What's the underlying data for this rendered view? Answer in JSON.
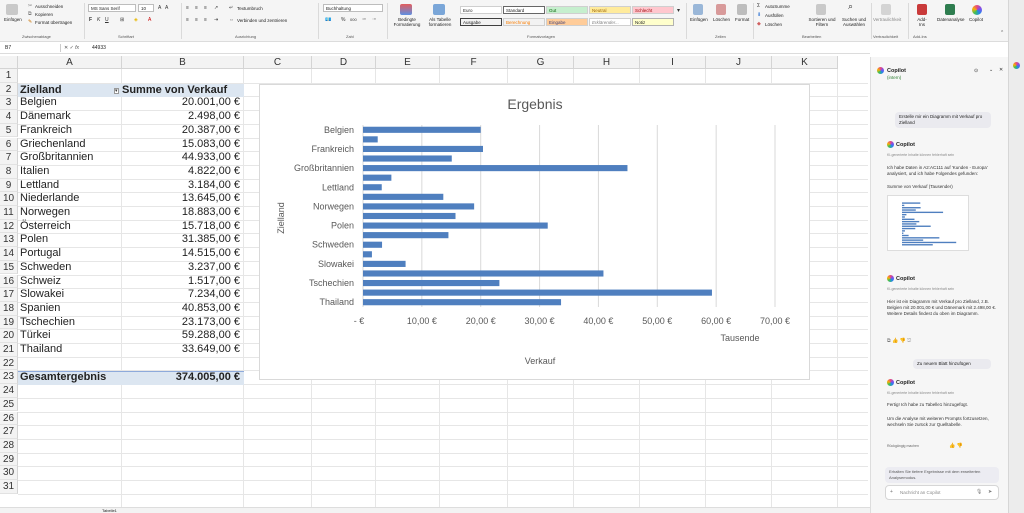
{
  "ribbon": {
    "clipboard": {
      "paste": "Einfügen",
      "cut": "Ausschneiden",
      "copy": "Kopieren",
      "format": "Format übertragen",
      "group": "Zwischenablage"
    },
    "font": {
      "name": "MS Sans Serif",
      "size": "10",
      "group": "Schriftart"
    },
    "alignment": {
      "wrap": "Textumbruch",
      "merge": "Verbinden und zentrieren",
      "group": "Ausrichtung"
    },
    "number": {
      "format": "Buchhaltung",
      "group": "Zahl"
    },
    "cond": {
      "conditional": "Bedingte Formatierung",
      "table": "Als Tabelle formatieren"
    },
    "styles": {
      "euro": "Euro",
      "standard": "Standard",
      "gut": "Gut",
      "neutral": "Neutral",
      "schlecht": "Schlecht",
      "ausgabe": "Ausgabe",
      "berechnung": "Berechnung",
      "eingabe": "Eingabe",
      "erklaerend": "Erklärender...",
      "notiz": "Notiz",
      "group": "Formatvorlagen"
    },
    "cells": {
      "insert": "Einfügen",
      "delete": "Löschen",
      "format": "Format",
      "group": "Zellen"
    },
    "edit": {
      "autosum": "AutoSumme",
      "fill": "Ausfüllen",
      "clear": "Löschen",
      "sort": "Sortieren und Filtern",
      "find": "Suchen und Auswählen",
      "group": "Bearbeiten"
    },
    "sensitivity": {
      "label": "Vertraulichkeit",
      "group": "Vertraulichkeit"
    },
    "addins": {
      "label": "Add-Ins",
      "group": "Add-Ins"
    },
    "analyze": {
      "label": "Datenanalyse"
    },
    "copilot": {
      "label": "Copilot"
    }
  },
  "formula_bar": {
    "name_box": "B7",
    "fx": "fx",
    "value": "44933"
  },
  "columns": [
    "A",
    "B",
    "C",
    "D",
    "E",
    "F",
    "G",
    "H",
    "I",
    "J",
    "K"
  ],
  "rows": [
    "1",
    "2",
    "3",
    "4",
    "5",
    "6",
    "7",
    "8",
    "9",
    "10",
    "11",
    "12",
    "13",
    "14",
    "15",
    "16",
    "17",
    "18",
    "19",
    "20",
    "21",
    "22",
    "23",
    "24",
    "25",
    "26",
    "27",
    "28",
    "29",
    "30",
    "31"
  ],
  "table": {
    "header": {
      "a": "Zielland",
      "b": "Summe von Verkauf"
    },
    "data": [
      {
        "country": "Belgien",
        "value": "20.001,00 €"
      },
      {
        "country": "Dänemark",
        "value": "2.498,00 €"
      },
      {
        "country": "Frankreich",
        "value": "20.387,00 €"
      },
      {
        "country": "Griechenland",
        "value": "15.083,00 €"
      },
      {
        "country": "Großbritannien",
        "value": "44.933,00 €"
      },
      {
        "country": "Italien",
        "value": "4.822,00 €"
      },
      {
        "country": "Lettland",
        "value": "3.184,00 €"
      },
      {
        "country": "Niederlande",
        "value": "13.645,00 €"
      },
      {
        "country": "Norwegen",
        "value": "18.883,00 €"
      },
      {
        "country": "Österreich",
        "value": "15.718,00 €"
      },
      {
        "country": "Polen",
        "value": "31.385,00 €"
      },
      {
        "country": "Portugal",
        "value": "14.515,00 €"
      },
      {
        "country": "Schweden",
        "value": "3.237,00 €"
      },
      {
        "country": "Schweiz",
        "value": "1.517,00 €"
      },
      {
        "country": "Slowakei",
        "value": "7.234,00 €"
      },
      {
        "country": "Spanien",
        "value": "40.853,00 €"
      },
      {
        "country": "Tschechien",
        "value": "23.173,00 €"
      },
      {
        "country": "Türkei",
        "value": "59.288,00 €"
      },
      {
        "country": "Thailand",
        "value": "33.649,00 €"
      }
    ],
    "total": {
      "a": "Gesamtergebnis",
      "b": "374.005,00 €"
    }
  },
  "chart_data": {
    "type": "bar",
    "title": "Ergebnis",
    "xlabel": "Verkauf",
    "ylabel": "Zielland",
    "unit_label": "Tausende",
    "categories": [
      "Belgien",
      "Dänemark",
      "Frankreich",
      "Griechenland",
      "Großbritannien",
      "Italien",
      "Lettland",
      "Niederlande",
      "Norwegen",
      "Österreich",
      "Polen",
      "Portugal",
      "Schweden",
      "Schweiz",
      "Slowakei",
      "Spanien",
      "Tschechien",
      "Türkei",
      "Thailand"
    ],
    "visible_category_labels": [
      "Belgien",
      "Frankreich",
      "Großbritannien",
      "Lettland",
      "Norwegen",
      "Polen",
      "Schweden",
      "Slowakei",
      "Tschechien",
      "Thailand"
    ],
    "values": [
      20.001,
      2.498,
      20.387,
      15.083,
      44.933,
      4.822,
      3.184,
      13.645,
      18.883,
      15.718,
      31.385,
      14.515,
      3.237,
      1.517,
      7.234,
      40.853,
      23.173,
      59.288,
      33.649
    ],
    "xlim": [
      0,
      70
    ],
    "xticks": [
      "-  €",
      "10,00 €",
      "20,00 €",
      "30,00 €",
      "40,00 €",
      "50,00 €",
      "60,00 €",
      "70,00 €"
    ],
    "bar_color": "#4f7fbf",
    "grid": true
  },
  "copilot": {
    "title": "Copilot",
    "subtitle": "(intern)",
    "user_msg1": "Erstelle mir ein Diagramm mit Verkauf pro Zielland",
    "bot_name": "Copilot",
    "ai_note": "KI-generierte Inhalte können fehlerhaft sein",
    "reply1": "Ich habe Daten in A2:AC111 auf 'Kunden - Europa' analysiert, und ich habe Folgendes gefunden:",
    "reply1b": "Summe von Verkauf (Tausender)",
    "reply2": "Hier ist ein Diagramm mit Verkauf pro Zielland, z.B. Belgien mit 20.001,00 € und Dänemark mit 2.498,00 €. Weitere Details findest du oben im Diagramm.",
    "user_msg2": "Zu neuem Blatt hinzufügen",
    "reply3a": "Fertig! Ich habe zu Tabelle1 hinzugefügt.",
    "reply3b": "Um die Analyse mit weiteren Prompts fortzusetzen, wechseln Sie zurück zur Quelltabelle.",
    "undo": "Rückgängig machen",
    "suggestion": "Erhalten Sie tiefere Ergebnisse mit dem erweiterten Analysemodus.",
    "input_placeholder": "Nachricht an Copilot"
  },
  "sheet_tab": "Tabelle1"
}
